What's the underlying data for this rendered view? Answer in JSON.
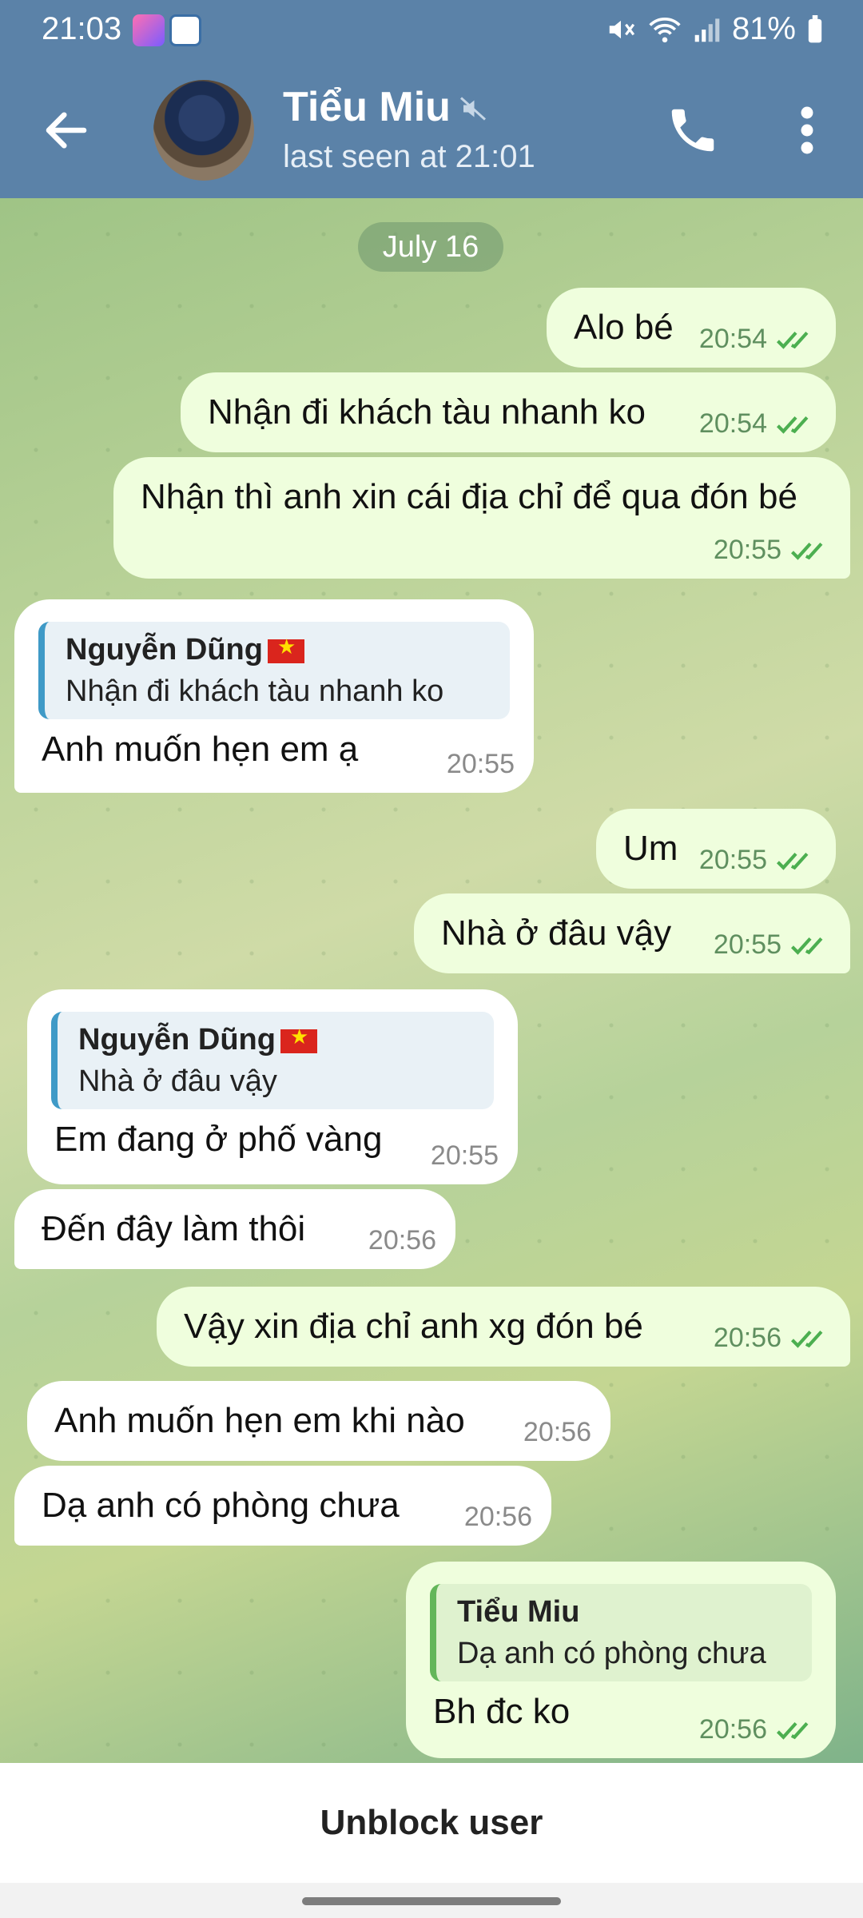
{
  "status_bar": {
    "time": "21:03",
    "battery": "81%"
  },
  "header": {
    "title": "Tiểu Miu",
    "status": "last seen at 21:01"
  },
  "chat": {
    "date": "July 16",
    "messages": [
      {
        "text": "Alo bé",
        "time": "20:54"
      },
      {
        "text": "Nhận đi khách tàu nhanh ko",
        "time": "20:54"
      },
      {
        "text": "Nhận thì anh xin cái địa chỉ để qua đón bé",
        "time": "20:55"
      },
      {
        "reply_name": "Nguyễn Dũng",
        "reply_text": "Nhận đi khách tàu nhanh ko",
        "text": "Anh muốn hẹn em ạ",
        "time": "20:55"
      },
      {
        "text": "Um",
        "time": "20:55"
      },
      {
        "text": "Nhà ở đâu vậy",
        "time": "20:55"
      },
      {
        "reply_name": "Nguyễn Dũng",
        "reply_text": "Nhà ở đâu vậy",
        "text": "Em đang ở phố vàng",
        "time": "20:55"
      },
      {
        "text": "Đến đây làm thôi",
        "time": "20:56"
      },
      {
        "text": "Vậy xin địa chỉ anh xg đón bé",
        "time": "20:56"
      },
      {
        "text": "Anh muốn hẹn em khi nào",
        "time": "20:56"
      },
      {
        "text": "Dạ anh có phòng chưa",
        "time": "20:56"
      },
      {
        "reply_name": "Tiểu Miu",
        "reply_text": "Dạ anh có phòng chưa",
        "text": "Bh đc ko",
        "time": "20:56"
      }
    ]
  },
  "bottom": {
    "unblock_label": "Unblock user"
  },
  "colors": {
    "header": "#5b82a8",
    "outgoing_bubble": "#effedd",
    "incoming_bubble": "#ffffff",
    "read_check": "#4caf50"
  }
}
